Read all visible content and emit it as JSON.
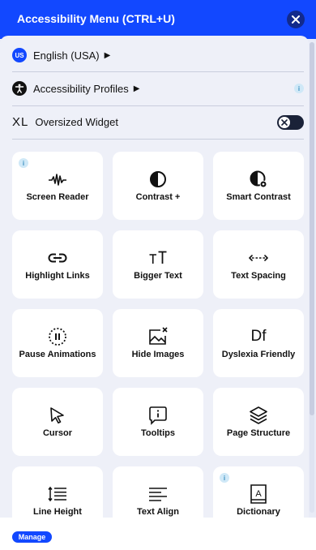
{
  "header": {
    "title": "Accessibility Menu (CTRL+U)"
  },
  "language": {
    "flag_text": "US",
    "label": "English (USA)"
  },
  "profiles": {
    "label": "Accessibility Profiles",
    "info": "i"
  },
  "oversized": {
    "badge": "XL",
    "label": "Oversized Widget",
    "toggle_state": "off"
  },
  "cards": [
    {
      "label": "Screen Reader",
      "icon": "waveform-icon",
      "info": "i"
    },
    {
      "label": "Contrast +",
      "icon": "contrast-icon"
    },
    {
      "label": "Smart Contrast",
      "icon": "smart-contrast-icon"
    },
    {
      "label": "Highlight Links",
      "icon": "link-icon"
    },
    {
      "label": "Bigger Text",
      "icon": "text-size-icon"
    },
    {
      "label": "Text Spacing",
      "icon": "text-spacing-icon"
    },
    {
      "label": "Pause Animations",
      "icon": "pause-icon"
    },
    {
      "label": "Hide Images",
      "icon": "hide-image-icon"
    },
    {
      "label": "Dyslexia Friendly",
      "icon": "dyslexia-icon",
      "icon_text": "Df"
    },
    {
      "label": "Cursor",
      "icon": "cursor-icon"
    },
    {
      "label": "Tooltips",
      "icon": "tooltip-icon"
    },
    {
      "label": "Page Structure",
      "icon": "layers-icon"
    },
    {
      "label": "Line Height",
      "icon": "line-height-icon"
    },
    {
      "label": "Text Align",
      "icon": "text-align-icon"
    },
    {
      "label": "Dictionary",
      "icon": "dictionary-icon",
      "icon_text": "A",
      "info": "i"
    }
  ],
  "footer": {
    "manage_label": "Manage"
  },
  "colors": {
    "accent": "#1248ff",
    "panel": "#eef0f8",
    "dark": "#122a8c"
  }
}
